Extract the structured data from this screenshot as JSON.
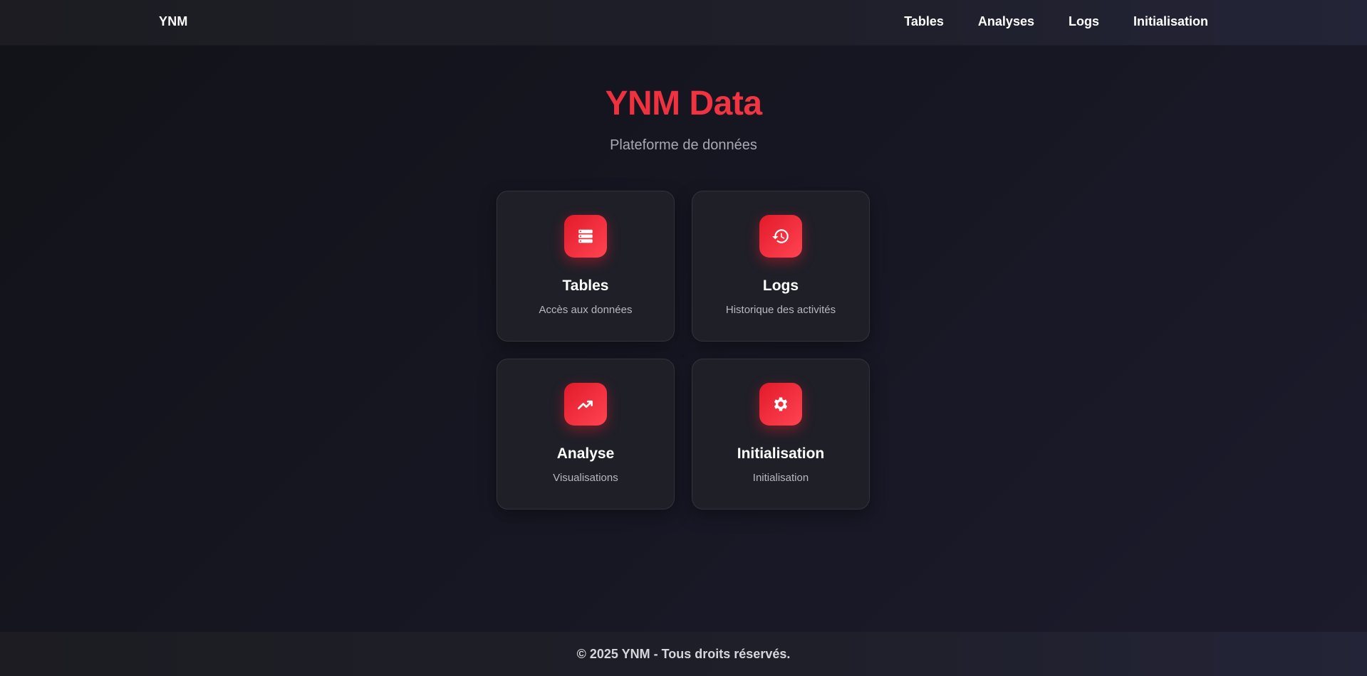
{
  "header": {
    "brand": "YNM",
    "nav": [
      {
        "label": "Tables"
      },
      {
        "label": "Analyses"
      },
      {
        "label": "Logs"
      },
      {
        "label": "Initialisation"
      }
    ]
  },
  "hero": {
    "title": "YNM Data",
    "subtitle": "Plateforme de données"
  },
  "cards": [
    {
      "title": "Tables",
      "description": "Accès aux données",
      "icon": "database-icon"
    },
    {
      "title": "Logs",
      "description": "Historique des activités",
      "icon": "history-icon"
    },
    {
      "title": "Analyse",
      "description": "Visualisations",
      "icon": "trending-up-icon"
    },
    {
      "title": "Initialisation",
      "description": "Initialisation",
      "icon": "gear-icon"
    }
  ],
  "footer": {
    "text": "© 2025 YNM - Tous droits réservés."
  },
  "colors": {
    "accent": "#e21b2b",
    "accent_light": "#ff4a55",
    "background": "#15151f",
    "card": "#1f1f28"
  }
}
